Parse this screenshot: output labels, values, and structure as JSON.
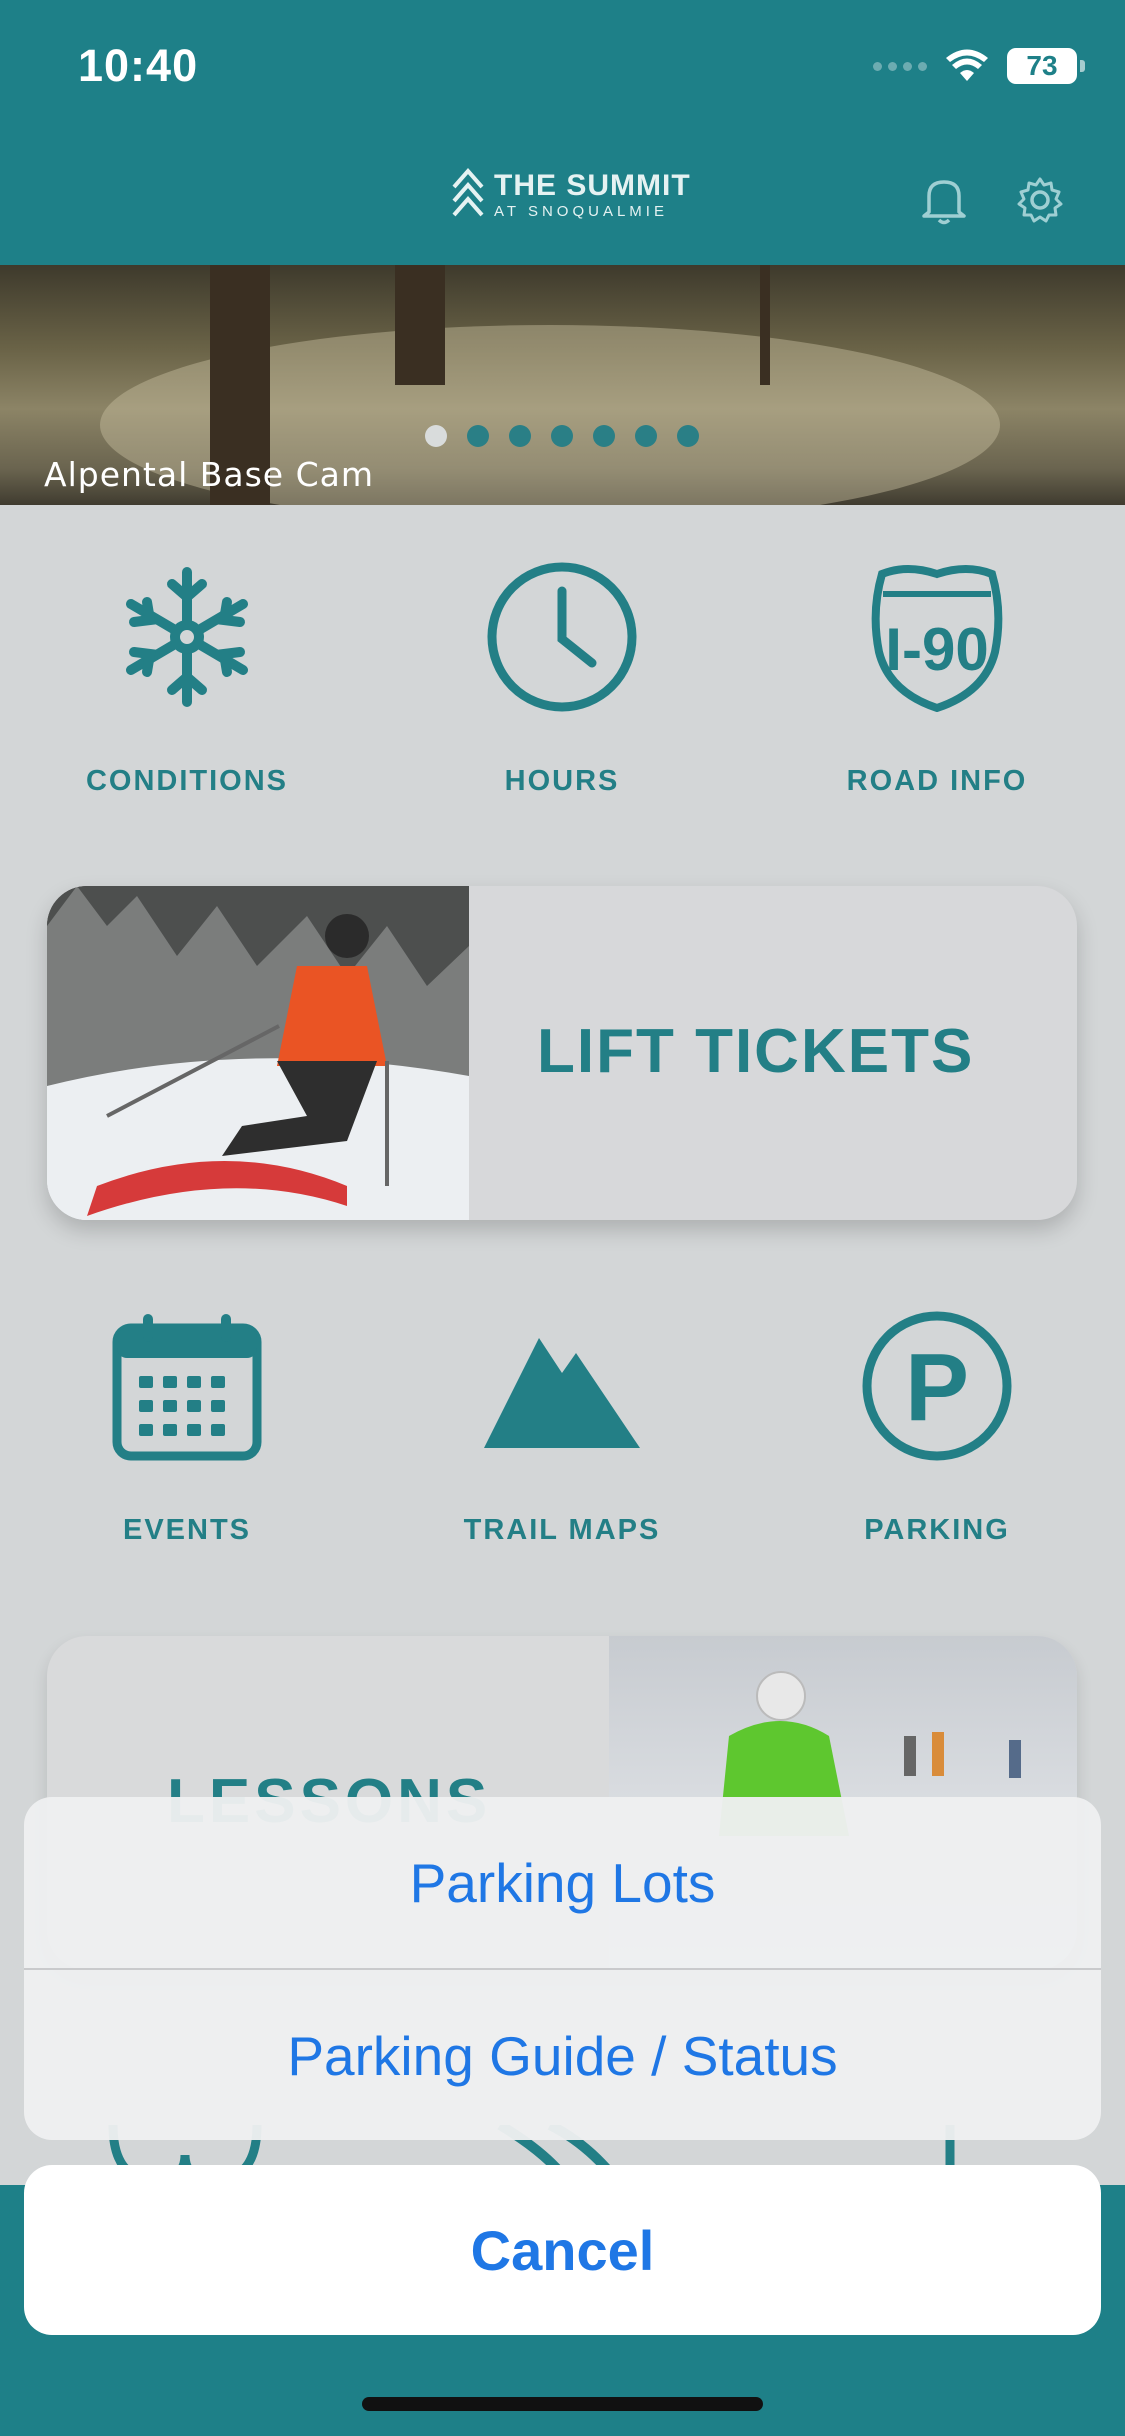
{
  "status_bar": {
    "time": "10:40",
    "battery": "73"
  },
  "header": {
    "logo_main": "THE SUMMIT",
    "logo_sub": "AT SNOQUALMIE"
  },
  "hero": {
    "caption": "Alpental Base Cam",
    "slide_count": 7,
    "active_slide": 1
  },
  "tiles_row1": [
    {
      "label": "CONDITIONS",
      "icon": "snowflake-icon"
    },
    {
      "label": "HOURS",
      "icon": "clock-icon"
    },
    {
      "label": "ROAD INFO",
      "icon": "i90-shield-icon"
    }
  ],
  "lift_tickets": {
    "label": "LIFT TICKETS"
  },
  "tiles_row2": [
    {
      "label": "EVENTS",
      "icon": "calendar-icon"
    },
    {
      "label": "TRAIL MAPS",
      "icon": "mountain-icon"
    },
    {
      "label": "PARKING",
      "icon": "parking-icon"
    }
  ],
  "lessons": {
    "label": "LESSONS"
  },
  "action_sheet": {
    "options": [
      "Parking Lots",
      "Parking Guide / Status"
    ],
    "cancel": "Cancel"
  },
  "colors": {
    "brand_teal": "#1e8088",
    "icon_teal": "#237f86",
    "ios_blue": "#1f77e5"
  }
}
